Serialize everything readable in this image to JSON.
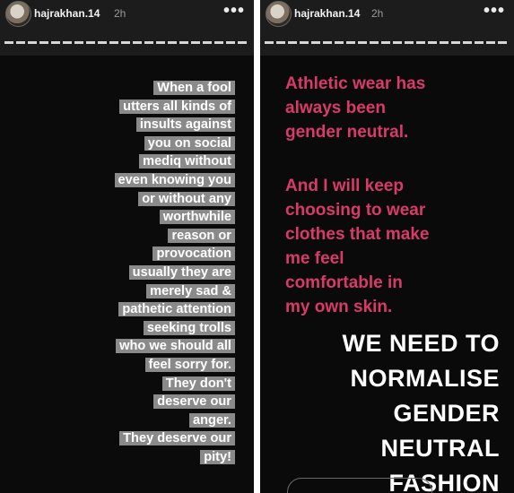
{
  "stories": [
    {
      "username": "hajrakhan.14",
      "time": "2h",
      "menu_icon": "more-dots-icon",
      "text_lines": [
        "When a fool",
        "utters all kinds of",
        "insults against",
        "you on social",
        "mediq without",
        "even knowing you",
        "or without any",
        "worthwhile",
        "reason or",
        "provocation",
        "usually they are",
        "merely sad &",
        "pathetic attention",
        "seeking trolls",
        "who we should all",
        "feel sorry for.",
        "They don't",
        "deserve our",
        "anger.",
        "They deserve our",
        "pity!"
      ]
    },
    {
      "username": "hajrakhan.14",
      "time": "2h",
      "menu_icon": "more-dots-icon",
      "pink_block_1": [
        "Athletic wear has",
        "always been",
        "gender neutral."
      ],
      "pink_block_2": [
        "And I will keep",
        "choosing to wear",
        "clothes that make",
        "me feel",
        "comfortable in",
        "my own skin."
      ],
      "big_block": [
        "WE NEED TO",
        "NORMALISE",
        "GENDER",
        "NEUTRAL",
        "FASHION"
      ]
    }
  ],
  "colors": {
    "background": "#0a0a0a",
    "header": "#1c1c1c",
    "highlight": "#8a8a8a",
    "pink": "#d83a69",
    "white": "#ffffff"
  }
}
